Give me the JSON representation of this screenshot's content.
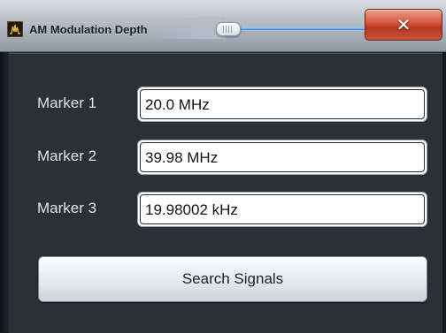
{
  "window": {
    "title": "AM Modulation Depth",
    "icon": "spectrum-icon",
    "close_icon_glyph": "✕"
  },
  "markers": [
    {
      "label": "Marker 1",
      "value": "20.0 MHz"
    },
    {
      "label": "Marker 2",
      "value": "39.98 MHz"
    },
    {
      "label": "Marker 3",
      "value": "19.98002 kHz"
    }
  ],
  "actions": {
    "search_label": "Search Signals"
  },
  "colors": {
    "close_button": "#c8442b",
    "slider_accent": "#3d89d9",
    "background": "#2b2f36"
  }
}
